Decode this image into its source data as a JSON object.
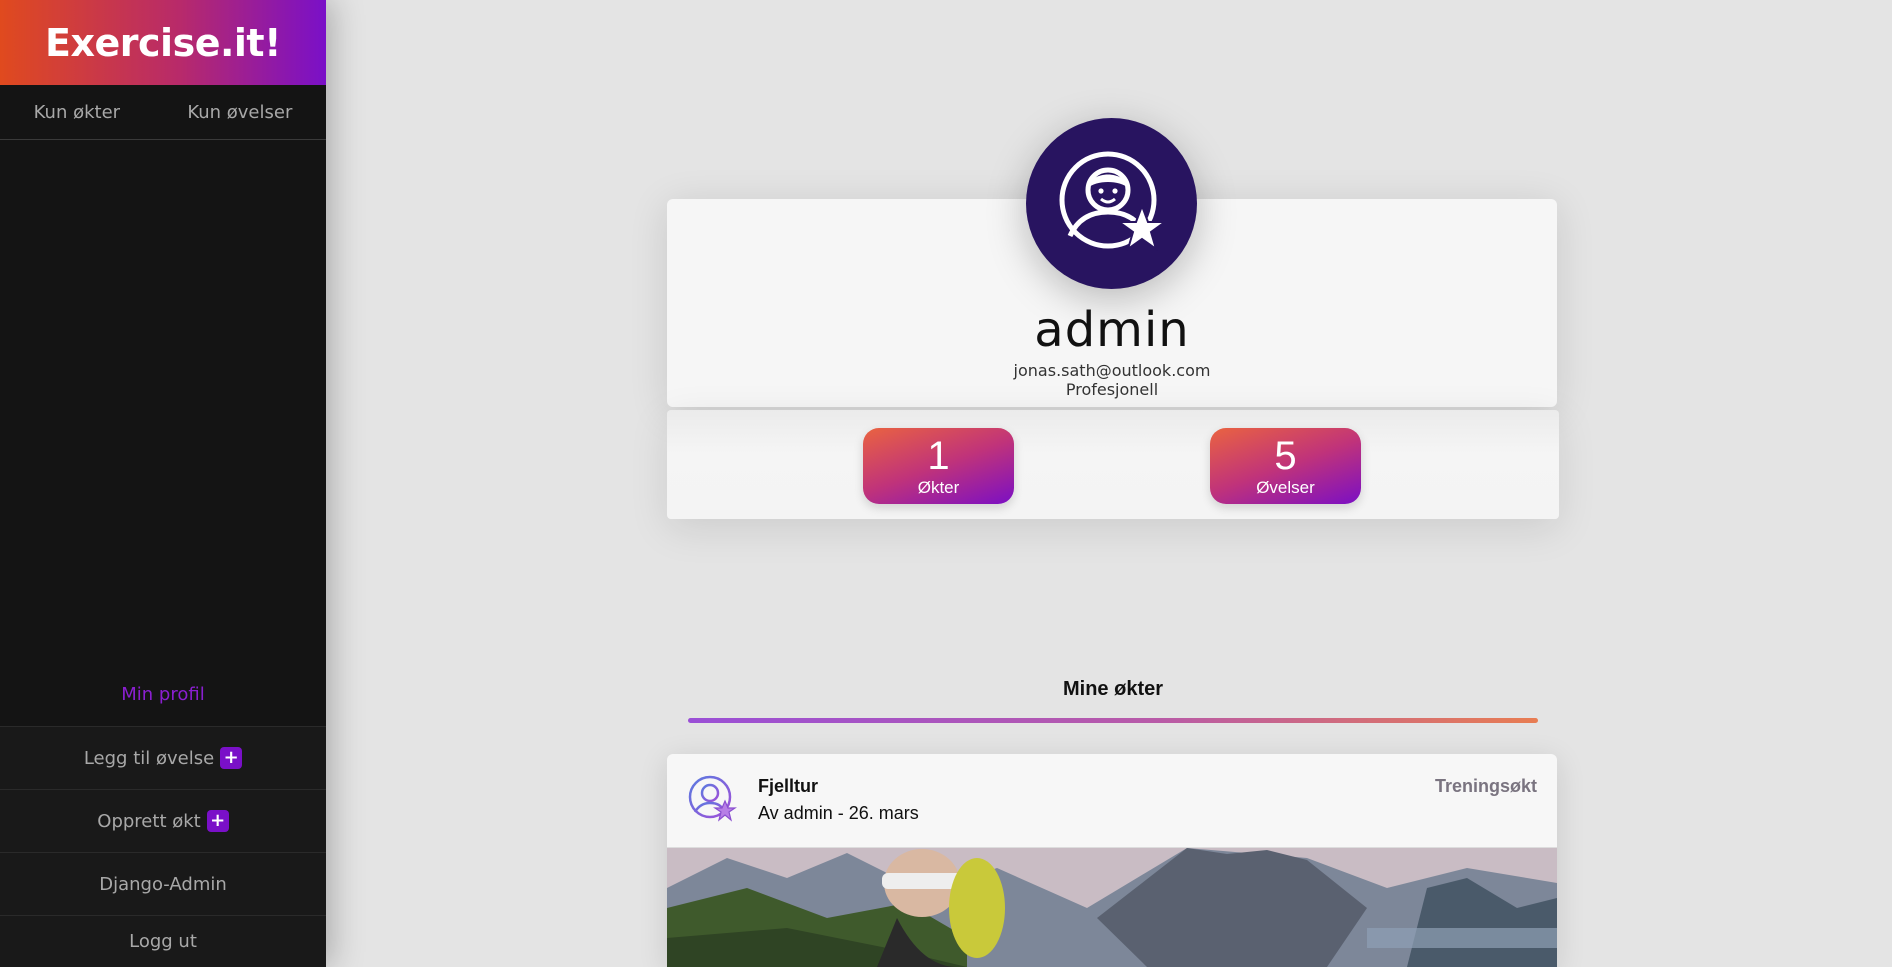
{
  "brand": {
    "title": "Exercise.it!"
  },
  "filters": {
    "workouts_only": "Kun økter",
    "exercises_only": "Kun øvelser"
  },
  "menu": {
    "profile": "Min profil",
    "add_exercise": "Legg til øvelse",
    "create_workout": "Opprett økt",
    "django_admin": "Django-Admin",
    "logout": "Logg ut",
    "plus_symbol": "+"
  },
  "profile": {
    "username": "admin",
    "email": "jonas.sath@outlook.com",
    "role": "Profesjonell",
    "avatar_icon": "user-star-icon"
  },
  "stats": [
    {
      "value": "1",
      "label": "Økter"
    },
    {
      "value": "5",
      "label": "Øvelser"
    }
  ],
  "section": {
    "title": "Mine økter"
  },
  "posts": [
    {
      "title": "Fjelltur",
      "meta": "Av admin - 26. mars",
      "type": "Treningsøkt",
      "image": "mountain-hiking-photo"
    }
  ],
  "colors": {
    "accent": "#7a10c8",
    "brand_start": "#e04a1e",
    "avatar_bg": "#281460"
  }
}
